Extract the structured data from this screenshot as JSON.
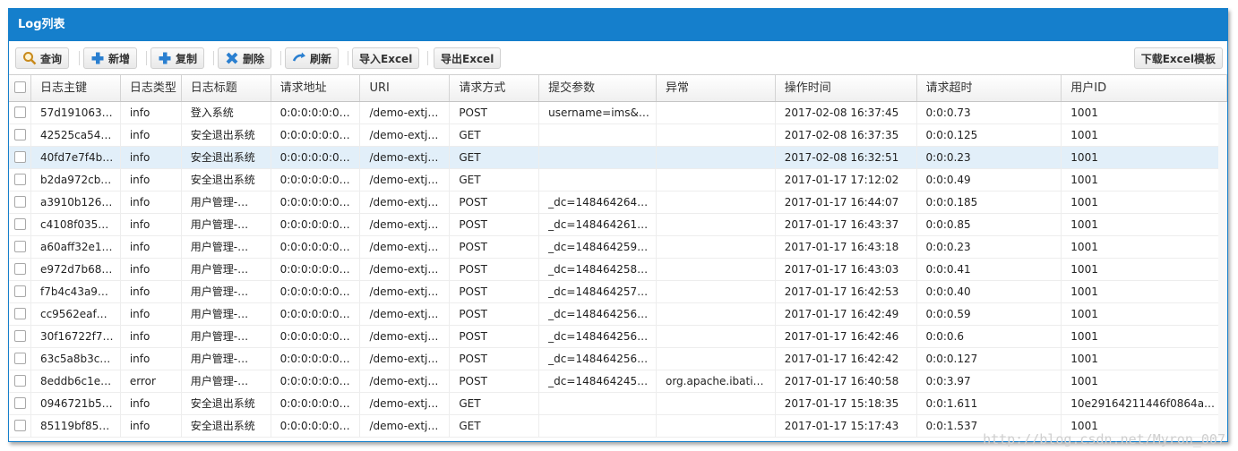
{
  "panel": {
    "title": "Log列表"
  },
  "toolbar": {
    "query": "查询",
    "add": "新增",
    "copy": "复制",
    "delete": "删除",
    "refresh": "刷新",
    "import": "导入Excel",
    "export": "导出Excel",
    "download_template": "下载Excel模板"
  },
  "columns": [
    "日志主键",
    "日志类型",
    "日志标题",
    "请求地址",
    "URI",
    "请求方式",
    "提交参数",
    "异常",
    "操作时间",
    "请求超时",
    "用户ID"
  ],
  "rows": [
    [
      "57d191063…",
      "info",
      "登入系统",
      "0:0:0:0:0:0…",
      "/demo-extj…",
      "POST",
      "username=ims&…",
      "",
      "2017-02-08 16:37:45",
      "0:0:0.73",
      "1001"
    ],
    [
      "42525ca54…",
      "info",
      "安全退出系统",
      "0:0:0:0:0:0…",
      "/demo-extj…",
      "GET",
      "",
      "",
      "2017-02-08 16:37:35",
      "0:0:0.125",
      "1001"
    ],
    [
      "40fd7e7f4b…",
      "info",
      "安全退出系统",
      "0:0:0:0:0:0…",
      "/demo-extj…",
      "GET",
      "",
      "",
      "2017-02-08 16:32:51",
      "0:0:0.23",
      "1001"
    ],
    [
      "b2da972cb…",
      "info",
      "安全退出系统",
      "0:0:0:0:0:0…",
      "/demo-extj…",
      "GET",
      "",
      "",
      "2017-01-17 17:12:02",
      "0:0:0.49",
      "1001"
    ],
    [
      "a3910b126…",
      "info",
      "用户管理-…",
      "0:0:0:0:0:0…",
      "/demo-extj…",
      "POST",
      "_dc=148464264…",
      "",
      "2017-01-17 16:44:07",
      "0:0:0.185",
      "1001"
    ],
    [
      "c4108f035…",
      "info",
      "用户管理-…",
      "0:0:0:0:0:0…",
      "/demo-extj…",
      "POST",
      "_dc=148464261…",
      "",
      "2017-01-17 16:43:37",
      "0:0:0.85",
      "1001"
    ],
    [
      "a60aff32e1…",
      "info",
      "用户管理-…",
      "0:0:0:0:0:0…",
      "/demo-extj…",
      "POST",
      "_dc=148464259…",
      "",
      "2017-01-17 16:43:18",
      "0:0:0.23",
      "1001"
    ],
    [
      "e972d7b68…",
      "info",
      "用户管理-…",
      "0:0:0:0:0:0…",
      "/demo-extj…",
      "POST",
      "_dc=148464258…",
      "",
      "2017-01-17 16:43:03",
      "0:0:0.41",
      "1001"
    ],
    [
      "f7b4c43a9…",
      "info",
      "用户管理-…",
      "0:0:0:0:0:0…",
      "/demo-extj…",
      "POST",
      "_dc=148464257…",
      "",
      "2017-01-17 16:42:53",
      "0:0:0.40",
      "1001"
    ],
    [
      "cc9562eaf…",
      "info",
      "用户管理-…",
      "0:0:0:0:0:0…",
      "/demo-extj…",
      "POST",
      "_dc=148464256…",
      "",
      "2017-01-17 16:42:49",
      "0:0:0.59",
      "1001"
    ],
    [
      "30f16722f7…",
      "info",
      "用户管理-…",
      "0:0:0:0:0:0…",
      "/demo-extj…",
      "POST",
      "_dc=148464256…",
      "",
      "2017-01-17 16:42:46",
      "0:0:0.6",
      "1001"
    ],
    [
      "63c5a8b3c…",
      "info",
      "用户管理-…",
      "0:0:0:0:0:0…",
      "/demo-extj…",
      "POST",
      "_dc=148464256…",
      "",
      "2017-01-17 16:42:42",
      "0:0:0.127",
      "1001"
    ],
    [
      "8eddb6c1e…",
      "error",
      "用户管理-…",
      "0:0:0:0:0:0…",
      "/demo-extj…",
      "POST",
      "_dc=148464245…",
      "org.apache.ibati…",
      "2017-01-17 16:40:58",
      "0:0:3.97",
      "1001"
    ],
    [
      "0946721b5…",
      "info",
      "安全退出系统",
      "0:0:0:0:0:0…",
      "/demo-extj…",
      "GET",
      "",
      "",
      "2017-01-17 15:18:35",
      "0:0:1.611",
      "10e29164211446f0864a…"
    ],
    [
      "85119bf85…",
      "info",
      "安全退出系统",
      "0:0:0:0:0:0…",
      "/demo-extj…",
      "GET",
      "",
      "",
      "2017-01-17 15:17:43",
      "0:0:1.537",
      "1001"
    ]
  ],
  "selected_row": 2,
  "watermark": "http://blog.csdn.net/Myron_007",
  "colors": {
    "header": "#157fcc",
    "selected": "#e2eff9"
  }
}
